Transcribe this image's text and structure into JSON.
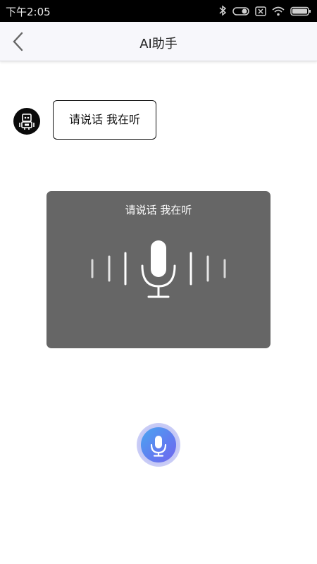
{
  "status_bar": {
    "time": "下午2:05"
  },
  "nav": {
    "title": "AI助手"
  },
  "chat": {
    "assistant_message": "请说话 我在听"
  },
  "voice_panel": {
    "prompt": "请说话 我在听"
  }
}
